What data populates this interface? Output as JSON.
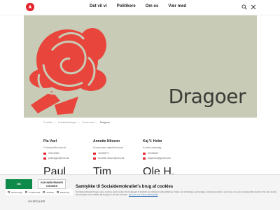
{
  "nav": {
    "items": [
      "Det vil vi",
      "Politikere",
      "Om os",
      "Vær med"
    ]
  },
  "colors": {
    "brand": "#e4202a",
    "hero_bg": "#c8cbb6",
    "rose": "#e8453c",
    "ok": "#0f8a48"
  },
  "icons": {
    "logo": "party-rose-logo",
    "search": "search-icon",
    "menu": "menu-icon"
  },
  "hero": {
    "title": "Dragoer"
  },
  "breadcrumb": [
    "Forside",
    "Lokalafdelinger",
    "Kommune",
    "Dragoer"
  ],
  "contacts": [
    {
      "name": "Pia Voel",
      "role": "Formand/formand",
      "phone": "20218450",
      "email": "piadrager@mvs.dk"
    },
    {
      "name": "Annette Nilsson",
      "role": "Kommune-næstformand",
      "phone": "40298170",
      "email": "annette.nilsson@dvb.dk"
    },
    {
      "name": "Kaj V. Holm",
      "role": "Kommunalvalg",
      "phone": "20298447",
      "email": "kajvholm@gmail.com"
    }
  ],
  "contacts_row2": [
    "Paul Bergen",
    "Tim Meisker",
    "Ole H. Hansen"
  ],
  "cookie": {
    "ok_label": "OK",
    "necessary_label": "KUN NØDVENDIGE COOKIES",
    "checkboxes": [
      "Nødvendige",
      "Funktionelle",
      "Statistik",
      "Marketing"
    ],
    "details_label": "VIS DETALJER",
    "title": "Samtykke til Socialdemokratiet's brug af cookies",
    "text": "Socialdemokratiet bruger egne cookies samt cookies fra tredjepart til statistik og målrettet markedsføring. Vælg, ved at tilvælge og fravælge cookies herunder. Læs mere om vores cookiepolitik nedenfor. Du kan ændre dit samtykke ved at klikke på knappen i bunden af siden.",
    "link": "Se mere om vores cookiepolitik"
  }
}
